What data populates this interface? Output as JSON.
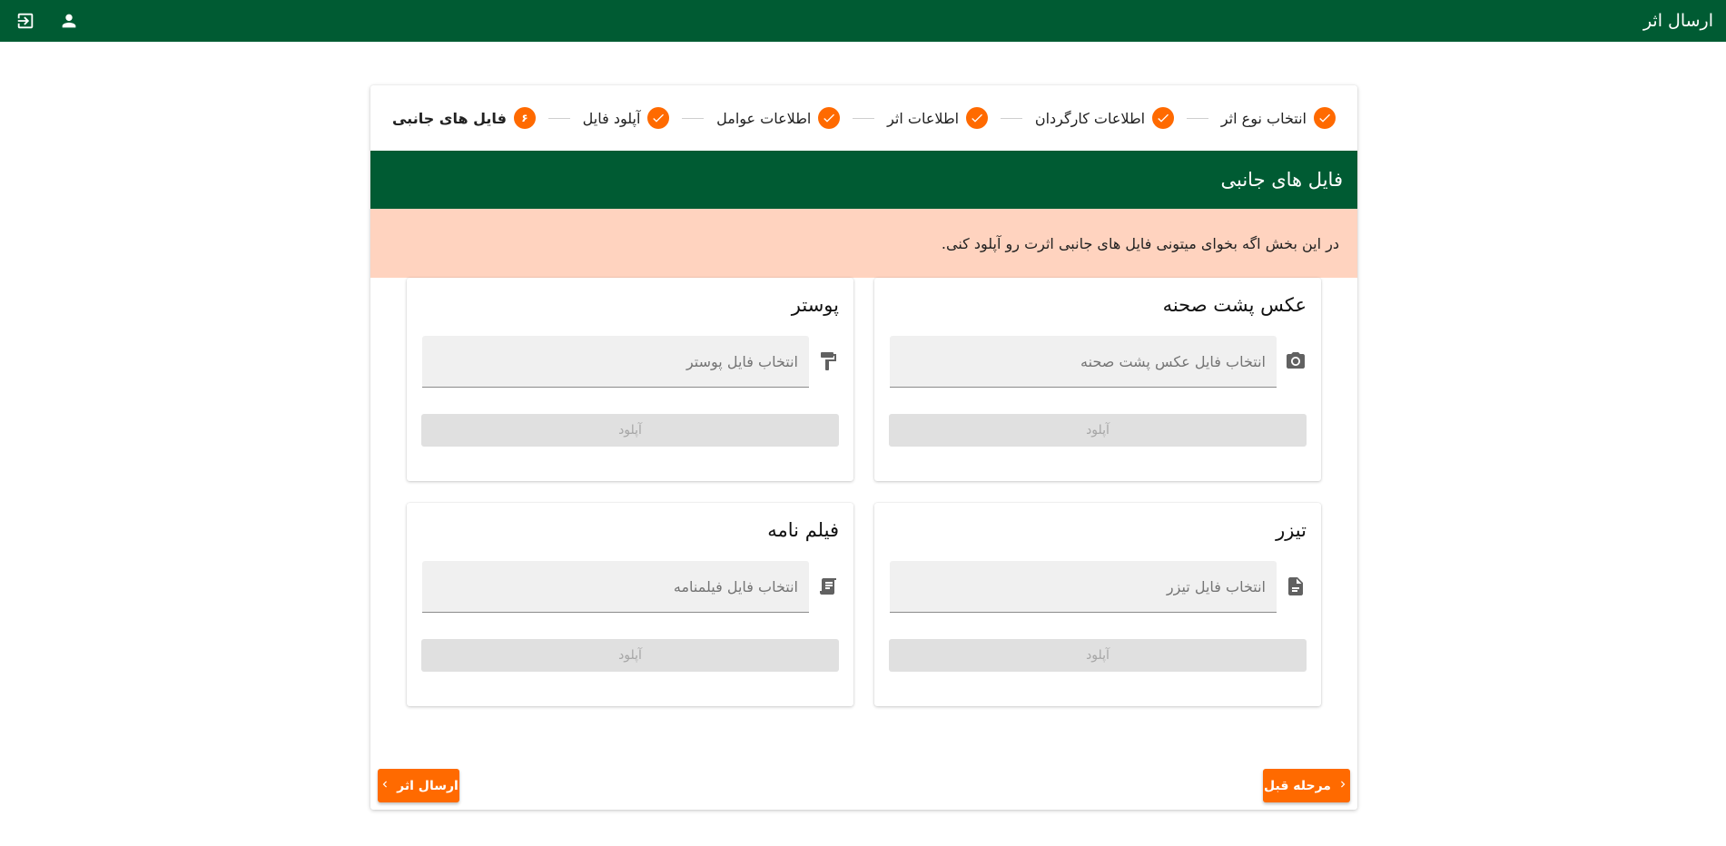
{
  "app_bar": {
    "title": "ارسال اثر",
    "logout_icon": "logout-icon",
    "account_icon": "account-icon",
    "bg_color": "#005b33"
  },
  "stepper": {
    "steps": [
      {
        "label": "انتخاب نوع اثر",
        "state": "done"
      },
      {
        "label": "اطلاعات کارگردان",
        "state": "done"
      },
      {
        "label": "اطلاعات اثر",
        "state": "done"
      },
      {
        "label": "اطلاعات عوامل",
        "state": "done"
      },
      {
        "label": "آپلود فایل",
        "state": "done"
      },
      {
        "label": "فایل های جانبی",
        "state": "active",
        "number": "۶"
      }
    ],
    "accent_color": "#ff6a00"
  },
  "section": {
    "title": "فایل های جانبی",
    "notice": "در این بخش اگه بخوای میتونی فایل های جانبی اثرت رو آپلود کنی."
  },
  "file_cards": {
    "backstage": {
      "title": "عکس پشت صحنه",
      "placeholder": "انتخاب فایل عکس پشت صحنه",
      "upload_label": "آپلود",
      "icon": "camera-icon"
    },
    "poster": {
      "title": "پوستر",
      "placeholder": "انتخاب فایل پوستر",
      "upload_label": "آپلود",
      "icon": "paint-roller-icon"
    },
    "teaser": {
      "title": "تیزر",
      "placeholder": "انتخاب فایل تیزر",
      "upload_label": "آپلود",
      "icon": "file-icon"
    },
    "screenplay": {
      "title": "فیلم نامه",
      "placeholder": "انتخاب فایل فیلمنامه",
      "upload_label": "آپلود",
      "icon": "script-icon"
    }
  },
  "actions": {
    "prev_label": "مرحله قبل",
    "submit_label": "ارسال اثر"
  }
}
